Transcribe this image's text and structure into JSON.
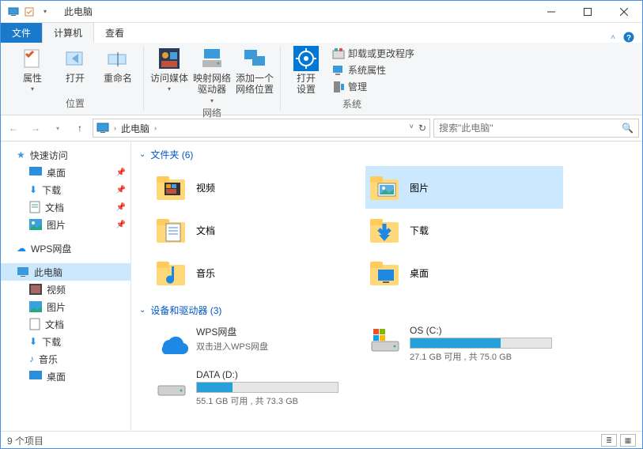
{
  "window": {
    "title": "此电脑"
  },
  "tabs": {
    "file": "文件",
    "computer": "计算机",
    "view": "查看"
  },
  "ribbon": {
    "group_location": {
      "label": "位置",
      "properties": "属性",
      "open": "打开",
      "rename": "重命名"
    },
    "group_network": {
      "label": "网络",
      "media": "访问媒体",
      "map_drive": "映射网络\n驱动器",
      "add_loc": "添加一个\n网络位置"
    },
    "group_system": {
      "label": "系统",
      "open_settings": "打开\n设置",
      "uninstall": "卸载或更改程序",
      "sysprops": "系统属性",
      "manage": "管理"
    }
  },
  "breadcrumb": {
    "root": "此电脑"
  },
  "search": {
    "placeholder": "搜索\"此电脑\""
  },
  "sidebar": {
    "quick": "快速访问",
    "desktop": "桌面",
    "downloads": "下载",
    "documents": "文档",
    "pictures": "图片",
    "wps": "WPS网盘",
    "thispc": "此电脑",
    "videos": "视频",
    "pictures2": "图片",
    "documents2": "文档",
    "downloads2": "下载",
    "music": "音乐",
    "desktop2": "桌面"
  },
  "content": {
    "folders_header": "文件夹 (6)",
    "folders": [
      {
        "name": "视频",
        "icon": "video"
      },
      {
        "name": "图片",
        "icon": "picture",
        "selected": true
      },
      {
        "name": "文档",
        "icon": "document"
      },
      {
        "name": "下载",
        "icon": "download"
      },
      {
        "name": "音乐",
        "icon": "music"
      },
      {
        "name": "桌面",
        "icon": "desktop"
      }
    ],
    "drives_header": "设备和驱动器 (3)",
    "drives": [
      {
        "name": "WPS网盘",
        "sub": "双击进入WPS网盘",
        "icon": "wps"
      },
      {
        "name": "OS (C:)",
        "free": "27.1 GB 可用",
        "total": "共 75.0 GB",
        "fill": 64,
        "icon": "windrive"
      },
      {
        "name": "DATA (D:)",
        "free": "55.1 GB 可用",
        "total": "共 73.3 GB",
        "fill": 25,
        "icon": "drive"
      }
    ]
  },
  "status": {
    "text": "9 个项目"
  }
}
